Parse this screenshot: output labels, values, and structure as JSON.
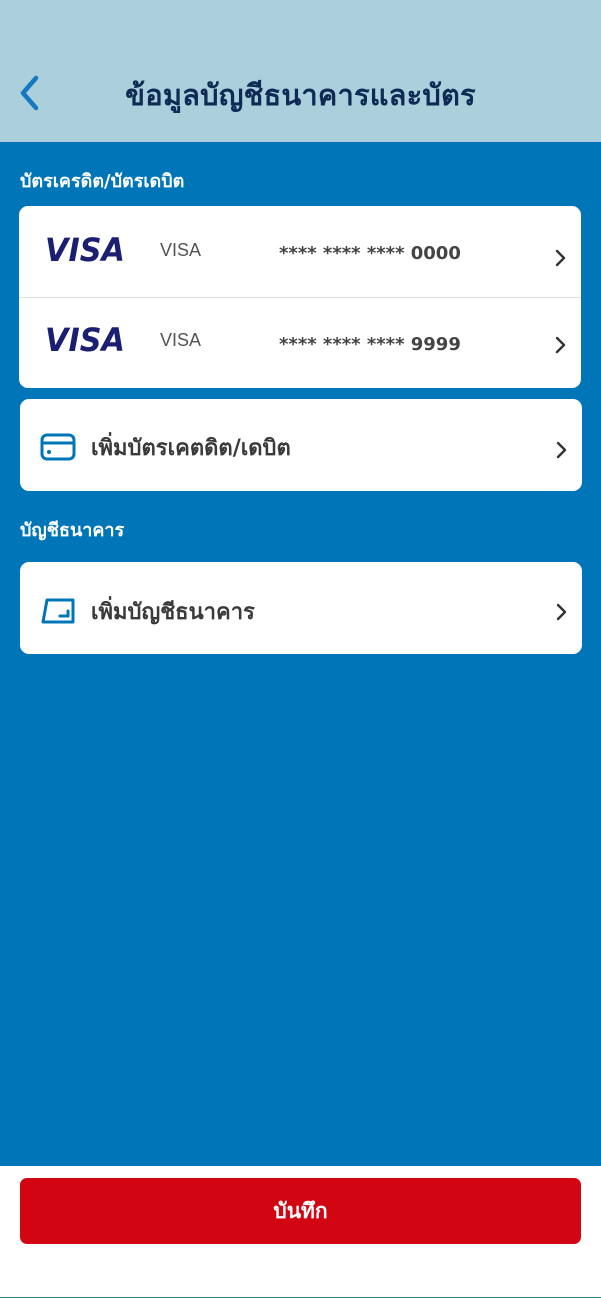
{
  "header": {
    "title": "ข้อมูลบัญชีธนาคารและบัตร"
  },
  "sections": {
    "cards_label": "บัตรเครดิต/บัตรเดบิต",
    "bank_label": "บัญชีธนาคาร"
  },
  "cards": [
    {
      "logo": "VISA",
      "brand": "VISA",
      "number": "**** **** **** 0000"
    },
    {
      "logo": "VISA",
      "brand": "VISA",
      "number": "**** **** **** 9999"
    }
  ],
  "actions": {
    "add_card": {
      "label": "เพิ่มบัตรเคตดิต/เดบิต",
      "icon": "credit-card-icon"
    },
    "add_bank": {
      "label": "เพิ่มบัญชีธนาคาร",
      "icon": "bank-book-icon"
    }
  },
  "footer": {
    "save_label": "บันทึก"
  },
  "colors": {
    "header_bg": "#abd0db",
    "main_bg": "#0075b8",
    "title": "#0e2a55",
    "accent": "#0075b8",
    "save_button": "#d20612",
    "visa": "#1a1f71"
  }
}
